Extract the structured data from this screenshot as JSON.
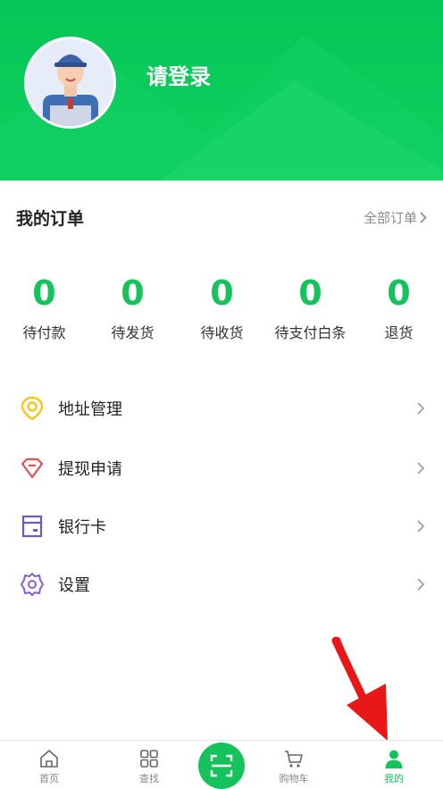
{
  "header": {
    "login_text": "请登录",
    "bg_color": "#06c657"
  },
  "orders": {
    "title": "我的订单",
    "all_link": "全部订单",
    "stats": [
      {
        "count": "0",
        "label": "待付款"
      },
      {
        "count": "0",
        "label": "待发货"
      },
      {
        "count": "0",
        "label": "待收货"
      },
      {
        "count": "0",
        "label": "待支付白条"
      },
      {
        "count": "0",
        "label": "退货"
      }
    ],
    "accent_color": "#16c25c"
  },
  "menu": {
    "items": [
      {
        "label": "地址管理",
        "icon": "location-pin-icon",
        "color": "#f5c518"
      },
      {
        "label": "提现申请",
        "icon": "diamond-icon",
        "color": "#e05050"
      },
      {
        "label": "银行卡",
        "icon": "card-icon",
        "color": "#6a5acd"
      },
      {
        "label": "设置",
        "icon": "gear-icon",
        "color": "#8a5cd6"
      }
    ]
  },
  "tabbar": {
    "items": [
      {
        "label": "首页",
        "icon": "home-icon"
      },
      {
        "label": "查找",
        "icon": "grid-icon"
      },
      {
        "label": "",
        "icon": "scan-icon"
      },
      {
        "label": "购物车",
        "icon": "cart-icon"
      },
      {
        "label": "我的",
        "icon": "user-icon"
      }
    ],
    "active_color": "#16c25c"
  }
}
